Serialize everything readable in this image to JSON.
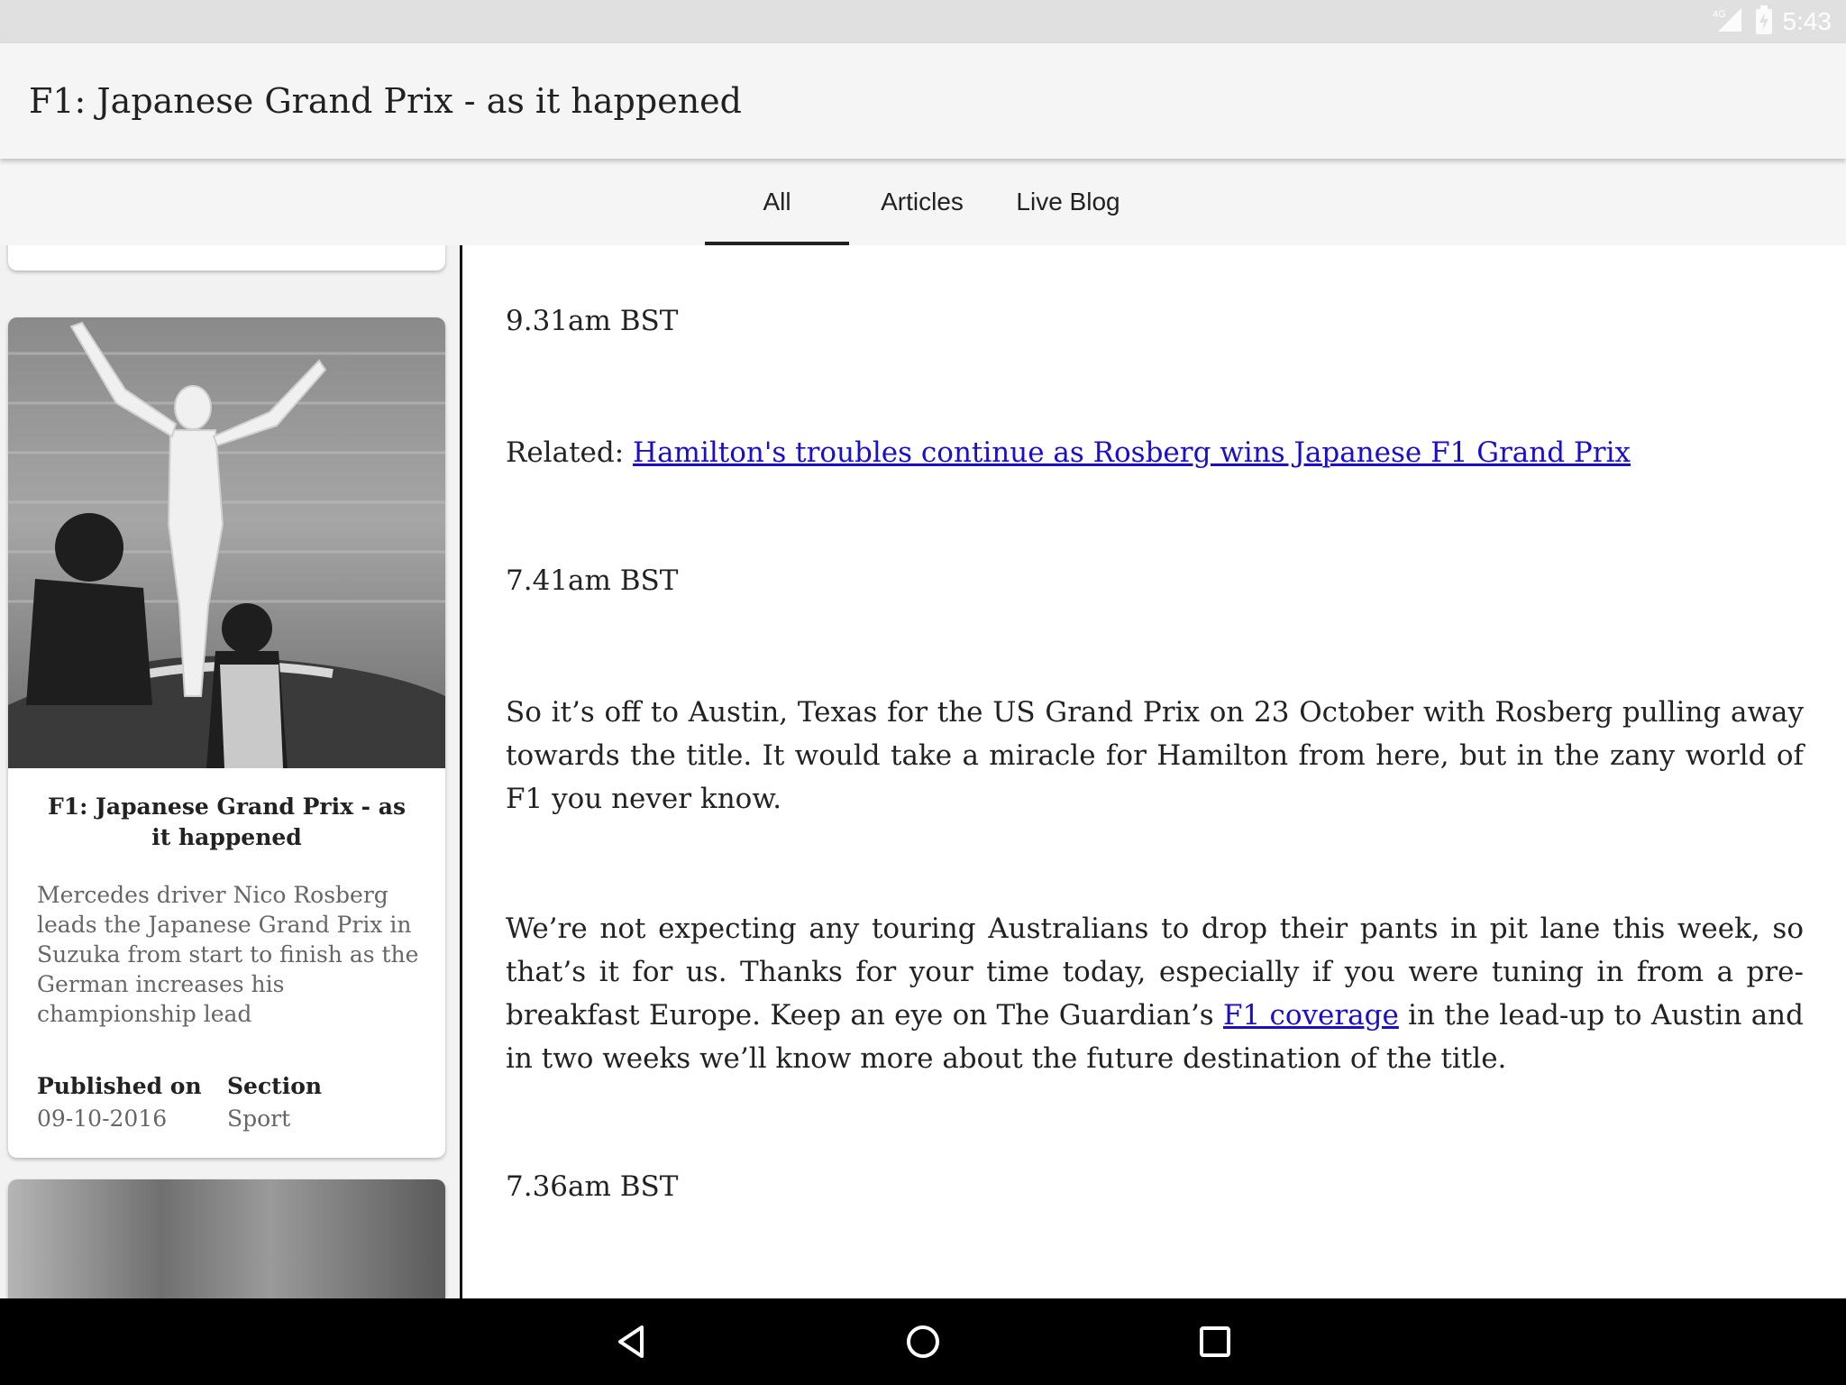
{
  "status_bar": {
    "time": "5:43",
    "network": "4G"
  },
  "app_bar": {
    "title": "F1: Japanese Grand Prix - as it happened"
  },
  "tabs": [
    {
      "label": "All",
      "selected": true
    },
    {
      "label": "Articles",
      "selected": false
    },
    {
      "label": "Live Blog",
      "selected": false
    }
  ],
  "card": {
    "title": "F1: Japanese Grand Prix - as it happened",
    "summary": "Mercedes driver Nico Rosberg leads the Japanese Grand Prix in Suzuka from start to finish as the German increases his championship lead",
    "published_label": "Published on",
    "published_value": "09-10-2016",
    "section_label": "Section",
    "section_value": "Sport"
  },
  "content": {
    "entries": [
      {
        "time": "9.31am BST"
      },
      {
        "time": "7.41am BST"
      },
      {
        "time": "7.36am BST"
      }
    ],
    "related_prefix": "Related: ",
    "related_link": "Hamilton's troubles continue as Rosberg wins Japanese F1 Grand Prix",
    "para1": "So it’s off to Austin, Texas for the US Grand Prix on 23 October with Rosberg pulling away towards the title. It would take a miracle for Hamilton from here, but in the zany world of F1 you never know.",
    "para2_before": "We’re not expecting any touring Australians to drop their pants in pit lane this week, so that’s it for us. Thanks for your time today, especially if you were tuning in from a pre-breakfast Europe. Keep an eye on The Guardian’s ",
    "para2_link": "F1 coverage",
    "para2_after": " in the lead-up to Austin and in two weeks we’ll know more about the future destination of the title."
  },
  "colors": {
    "link": "#1a0dcc",
    "app_bar_bg": "#f5f5f5",
    "status_bar_bg": "#e0e0e0",
    "nav_bar_bg": "#000000"
  },
  "icons": [
    "signal-icon",
    "battery-icon",
    "back-icon",
    "home-icon",
    "recents-icon"
  ]
}
